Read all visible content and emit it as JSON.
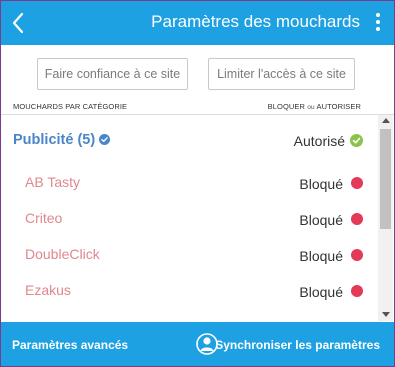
{
  "header": {
    "title": "Paramètres des mouchards",
    "back_icon": "chevron-left-icon",
    "menu_icon": "kebab-menu-icon",
    "background": "#1da1e2"
  },
  "actions": {
    "trust_label": "Faire confiance à ce site",
    "limit_label": "Limiter l'accès à ce site"
  },
  "columns": {
    "left": "MOUCHARDS PAR CATÉGORIE",
    "right_block": "BLOQUER",
    "right_or": "ou",
    "right_allow": "AUTORISER"
  },
  "category": {
    "name": "Publicité (5)",
    "status": "Autorisé",
    "status_color": "#8bc34a",
    "name_color": "#4a85c9"
  },
  "trackers": [
    {
      "name": "AB Tasty",
      "status": "Bloqué"
    },
    {
      "name": "Criteo",
      "status": "Bloqué"
    },
    {
      "name": "DoubleClick",
      "status": "Bloqué"
    },
    {
      "name": "Ezakus",
      "status": "Bloqué"
    }
  ],
  "colors": {
    "blocked": "#e33a58",
    "tracker_name": "#e0878f"
  },
  "footer": {
    "advanced_label": "Paramètres avancés",
    "sync_label": "Synchroniser les paramètres",
    "sync_icon": "user-circle-icon"
  }
}
